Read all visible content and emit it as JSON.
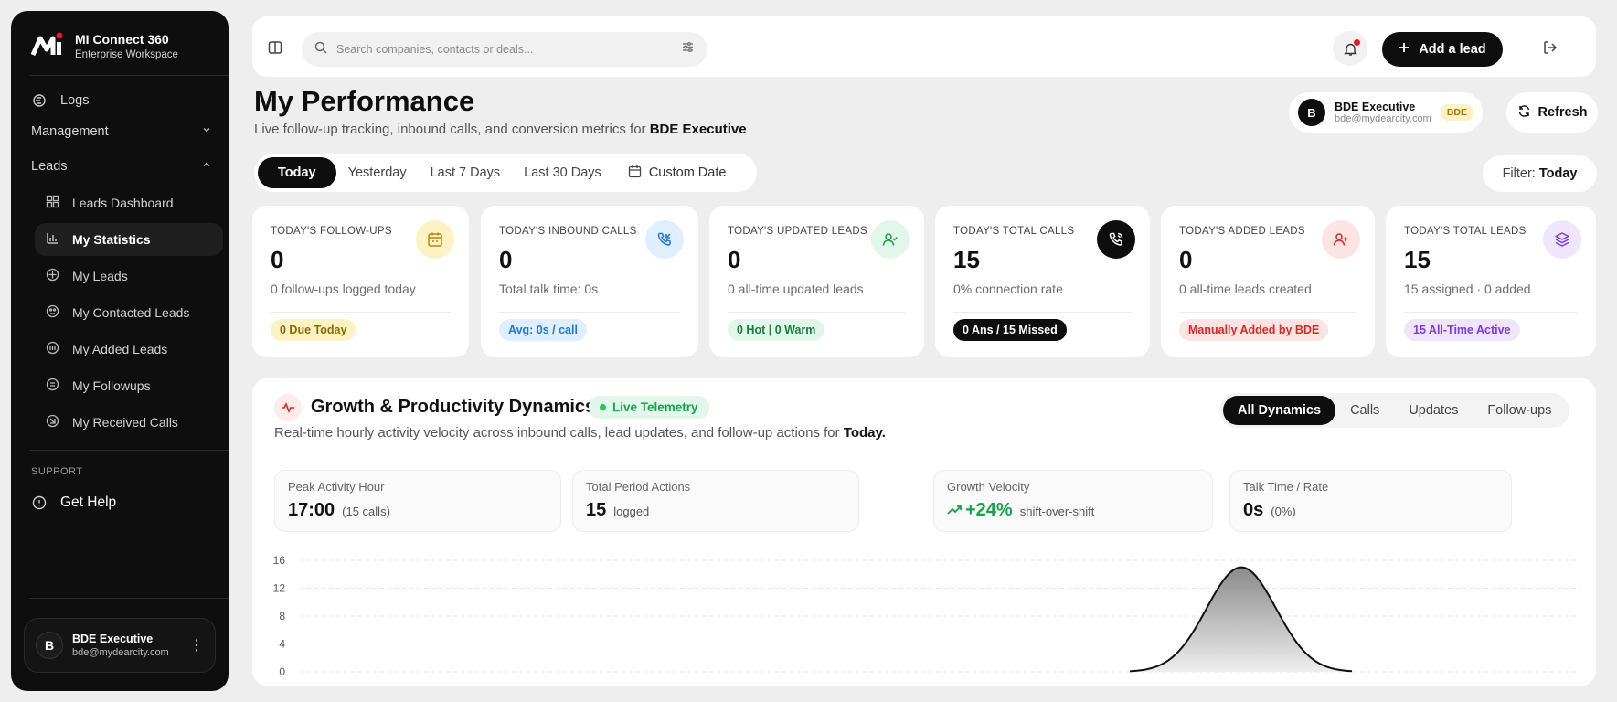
{
  "brand": {
    "name": "MI Connect 360",
    "workspace": "Enterprise Workspace"
  },
  "sidebar": {
    "logs": "Logs",
    "management": "Management",
    "leads": "Leads",
    "sub_items": [
      {
        "label": "Leads Dashboard"
      },
      {
        "label": "My Statistics"
      },
      {
        "label": "My Leads"
      },
      {
        "label": "My Contacted Leads"
      },
      {
        "label": "My Added Leads"
      },
      {
        "label": "My Followups"
      },
      {
        "label": "My Received Calls"
      }
    ],
    "support_label": "SUPPORT",
    "get_help": "Get Help",
    "user": {
      "initial": "B",
      "name": "BDE Executive",
      "email": "bde@mydearcity.com"
    }
  },
  "topbar": {
    "search_placeholder": "Search companies, contacts or deals...",
    "add_lead": "Add a lead"
  },
  "header": {
    "title": "My Performance",
    "subtitle": "Live follow-up tracking, inbound calls, and conversion metrics for",
    "subtitle_user": "BDE Executive",
    "user_chip": {
      "initial": "B",
      "name": "BDE Executive",
      "email": "bde@mydearcity.com",
      "role": "BDE"
    },
    "refresh": "Refresh"
  },
  "date_filter": {
    "tabs": [
      "Today",
      "Yesterday",
      "Last 7 Days",
      "Last 30 Days"
    ],
    "custom": "Custom Date",
    "filter_label": "Filter:",
    "filter_value": "Today"
  },
  "stats": [
    {
      "label": "TODAY'S FOLLOW-UPS",
      "value": "0",
      "sub": "0 follow-ups logged today",
      "badge": "0 Due Today"
    },
    {
      "label": "TODAY'S INBOUND CALLS",
      "value": "0",
      "sub": "Total talk time: 0s",
      "badge": "Avg: 0s / call"
    },
    {
      "label": "TODAY'S UPDATED LEADS",
      "value": "0",
      "sub": "0 all-time updated leads",
      "badge": "0 Hot | 0 Warm"
    },
    {
      "label": "TODAY'S TOTAL CALLS",
      "value": "15",
      "sub": "0% connection rate",
      "badge": "0 Ans / 15 Missed"
    },
    {
      "label": "TODAY'S ADDED LEADS",
      "value": "0",
      "sub": "0 all-time leads created",
      "badge": "Manually Added by BDE"
    },
    {
      "label": "TODAY'S TOTAL LEADS",
      "value": "15",
      "sub": "15 assigned · 0 added",
      "badge": "15 All-Time Active"
    }
  ],
  "dynamics": {
    "title": "Growth & Productivity Dynamics",
    "telemetry": "Live Telemetry",
    "subtitle": "Real-time hourly activity velocity across inbound calls, lead updates, and follow-up actions for",
    "subtitle_period": "Today.",
    "tabs": [
      "All Dynamics",
      "Calls",
      "Updates",
      "Follow-ups"
    ],
    "metrics": [
      {
        "label": "Peak Activity Hour",
        "value": "17:00",
        "suffix": "(15 calls)"
      },
      {
        "label": "Total Period Actions",
        "value": "15",
        "suffix": "logged"
      },
      {
        "label": "Growth Velocity",
        "value": "+24%",
        "suffix": "shift-over-shift"
      },
      {
        "label": "Talk Time / Rate",
        "value": "0s",
        "suffix": "(0%)"
      }
    ]
  },
  "chart_data": {
    "type": "area",
    "y_ticks": [
      "16",
      "12",
      "8",
      "4",
      "0"
    ],
    "ylim": [
      0,
      16
    ],
    "peak_value": 15,
    "grid": true
  }
}
